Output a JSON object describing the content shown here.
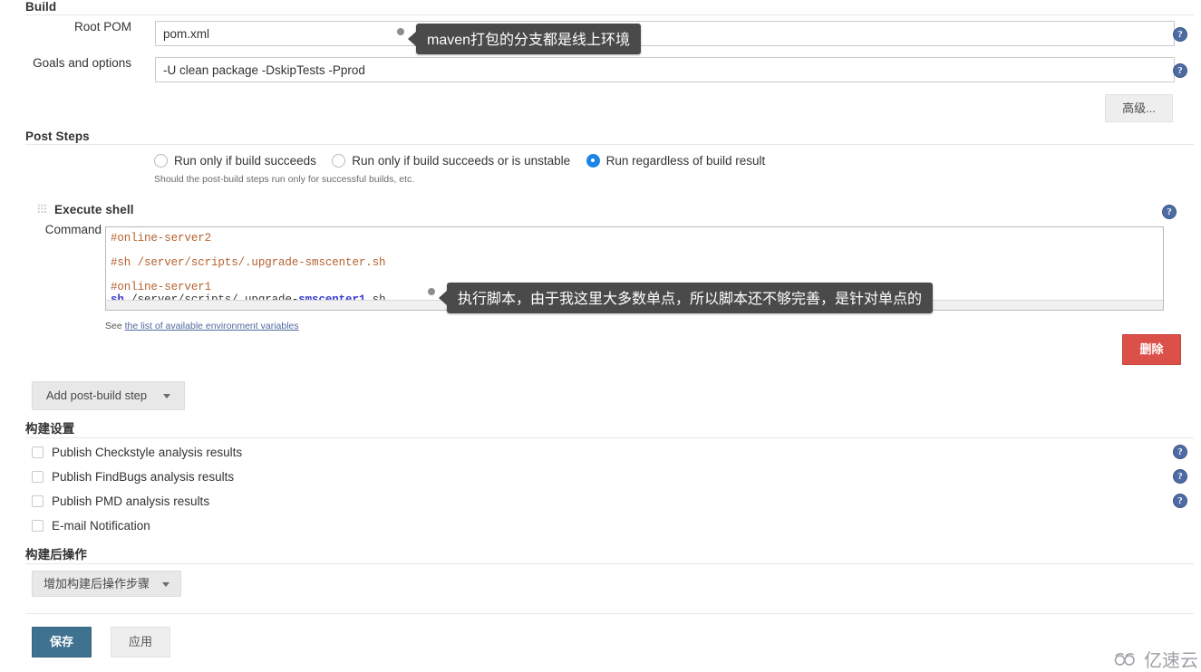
{
  "build": {
    "heading": "Build",
    "root_pom": {
      "label": "Root POM",
      "value": "pom.xml"
    },
    "goals": {
      "label": "Goals and options",
      "value": "-U clean package -DskipTests -Pprod"
    },
    "advanced_button": "高级..."
  },
  "post_steps": {
    "heading": "Post Steps",
    "radios": [
      {
        "label": "Run only if build succeeds",
        "selected": false
      },
      {
        "label": "Run only if build succeeds or is unstable",
        "selected": false
      },
      {
        "label": "Run regardless of build result",
        "selected": true
      }
    ],
    "hint": "Should the post-build steps run only for successful builds, etc."
  },
  "execute_shell": {
    "title": "Execute shell",
    "command_label": "Command",
    "command_lines": [
      {
        "text": "#online-server2",
        "style": "comment"
      },
      {
        "text": "",
        "style": "plain"
      },
      {
        "text": "#sh /server/scripts/.upgrade-smscenter.sh",
        "style": "comment"
      },
      {
        "text": "",
        "style": "plain"
      },
      {
        "text": "#online-server1",
        "style": "comment"
      }
    ],
    "command_last_line": {
      "keyword": "sh",
      "mid": " /server/scripts/.upgrade-",
      "keyword2": "smscenter1",
      "tail": ".sh"
    },
    "see_prefix": "See ",
    "see_link": "the list of available environment variables",
    "delete_button": "删除"
  },
  "add_post_build": {
    "label": "Add post-build step"
  },
  "build_settings": {
    "heading": "构建设置",
    "checkboxes": [
      {
        "label": "Publish Checkstyle analysis results",
        "checked": false,
        "help": true
      },
      {
        "label": "Publish FindBugs analysis results",
        "checked": false,
        "help": true
      },
      {
        "label": "Publish PMD analysis results",
        "checked": false,
        "help": true
      },
      {
        "label": "E-mail Notification",
        "checked": false,
        "help": false
      }
    ]
  },
  "post_build_actions": {
    "heading": "构建后操作",
    "add_step_button": "增加构建后操作步骤"
  },
  "footer": {
    "save": "保存",
    "apply": "应用"
  },
  "tooltips": {
    "root_pom_tip": "maven打包的分支都是线上环境",
    "shell_tip": "执行脚本，由于我这里大多数单点，所以脚本还不够完善，是针对单点的"
  },
  "watermark": {
    "text": "亿速云",
    "icon": "cloud-icon"
  },
  "colors": {
    "accent_radio": "#1b84e7",
    "save_button": "#3f7291",
    "delete_button": "#db5049",
    "help_icon": "#4e6ca3",
    "comment": "#b5622f",
    "keyword": "#3b3bcc",
    "tooltip_bg": "#4a4a4a"
  }
}
